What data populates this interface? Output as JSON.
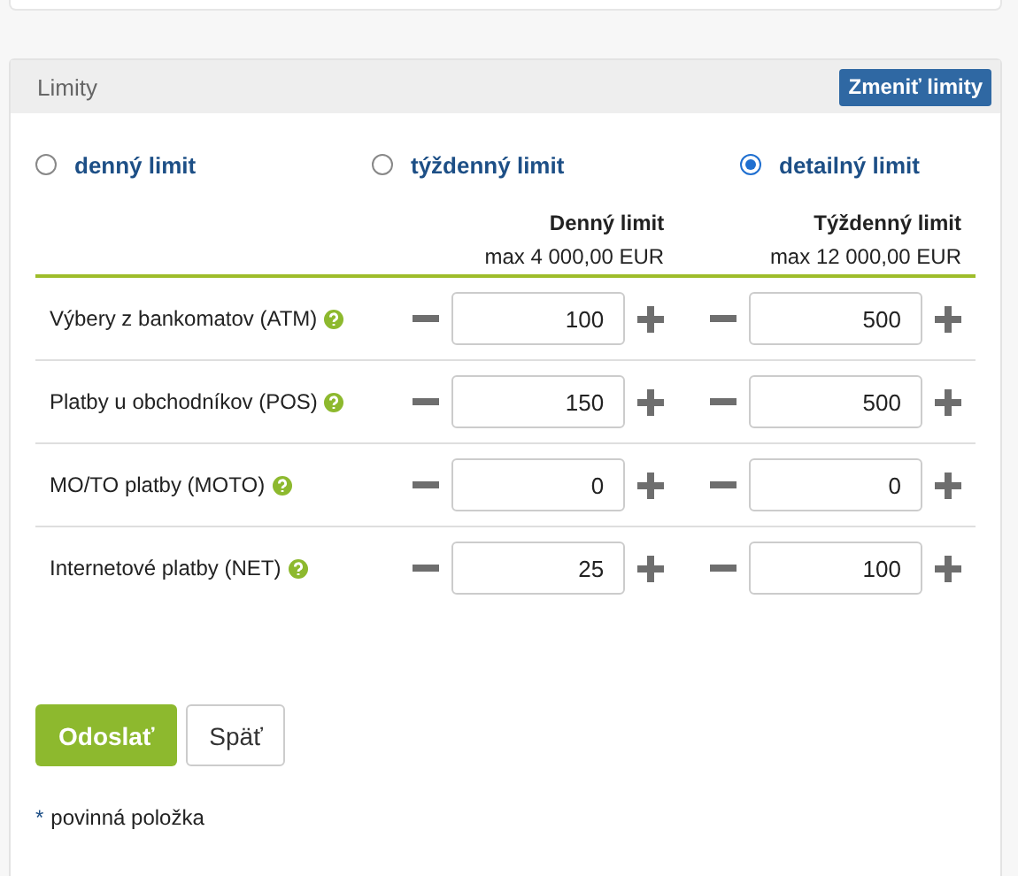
{
  "panel": {
    "title": "Limity",
    "action": "Zmeniť limity"
  },
  "modes": [
    {
      "label": "denný limit",
      "selected": false
    },
    {
      "label": "týždenný limit",
      "selected": false
    },
    {
      "label": "detailný limit",
      "selected": true
    }
  ],
  "columns": [
    {
      "title": "Denný limit",
      "max": "max 4 000,00 EUR"
    },
    {
      "title": "Týždenný limit",
      "max": "max 12 000,00 EUR"
    }
  ],
  "rows": [
    {
      "label": "Výbery z bankomatov (ATM)",
      "values": [
        "100",
        "500"
      ]
    },
    {
      "label": "Platby u obchodníkov (POS)",
      "values": [
        "150",
        "500"
      ]
    },
    {
      "label": "MO/TO platby (MOTO)",
      "values": [
        "0",
        "0"
      ]
    },
    {
      "label": "Internetové platby (NET)",
      "values": [
        "25",
        "100"
      ]
    }
  ],
  "buttons": [
    {
      "label": "Odoslať",
      "kind": "primary"
    },
    {
      "label": "Späť",
      "kind": "secondary"
    }
  ],
  "required_mark": "*",
  "required_note": "povinná položka"
}
